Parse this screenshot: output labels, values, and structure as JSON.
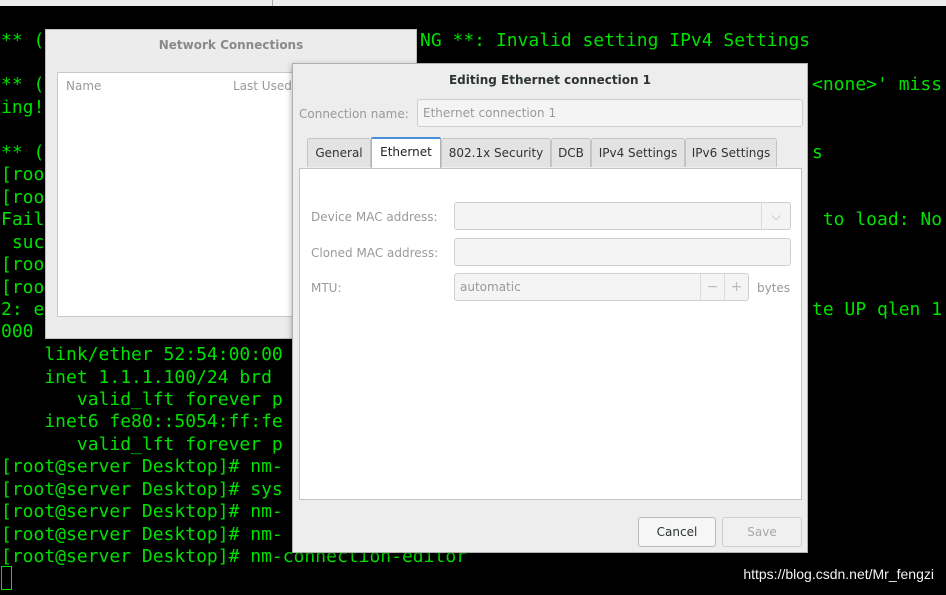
{
  "terminal": {
    "lines": [
      "** (",
      "** (",
      "ing!",
      "** (",
      "[roo",
      "[roo",
      "Fail",
      " suc",
      "[roo",
      "[roo",
      "2: e",
      "000 ",
      "    link/ether 52:54:00:00",
      "    inet 1.1.1.100/24 brd ",
      "       valid_lft forever p",
      "    inet6 fe80::5054:ff:fe",
      "       valid_lft forever p",
      "[root@server Desktop]# nm-",
      "[root@server Desktop]# sys",
      "[root@server Desktop]# nm-",
      "[root@server Desktop]# nm-",
      "[root@server Desktop]# nm-connection-editor"
    ],
    "right_fragments": [
      "NG **: Invalid setting IPv4 Settings",
      "<none>' miss",
      "s",
      " to load: No",
      "te UP qlen 1"
    ],
    "text_color": "#00e100",
    "watermark": "https://blog.csdn.net/Mr_fengzi"
  },
  "network_connections": {
    "title": "Network Connections",
    "columns": [
      "Name",
      "Last Used"
    ]
  },
  "dialog": {
    "title": "Editing Ethernet connection 1",
    "connection_name_label": "Connection name:",
    "connection_name_value": "Ethernet connection 1",
    "tabs": [
      "General",
      "Ethernet",
      "802.1x Security",
      "DCB",
      "IPv4 Settings",
      "IPv6 Settings"
    ],
    "active_tab": "Ethernet",
    "accent_color": "#4a90d9",
    "fields": {
      "device_mac_label": "Device MAC address:",
      "device_mac_value": "",
      "cloned_mac_label": "Cloned MAC address:",
      "cloned_mac_value": "",
      "mtu_label": "MTU:",
      "mtu_value": "automatic",
      "mtu_unit": "bytes",
      "minus": "−",
      "plus": "+",
      "arrow": "⌵"
    },
    "buttons": {
      "cancel": "Cancel",
      "save": "Save"
    }
  }
}
